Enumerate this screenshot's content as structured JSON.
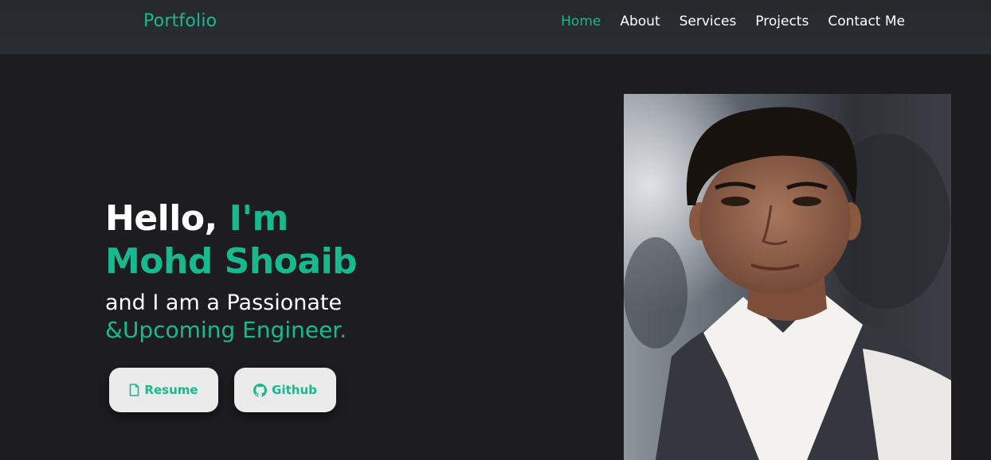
{
  "navbar": {
    "brand": "Portfolio",
    "links": [
      {
        "label": "Home",
        "active": true
      },
      {
        "label": "About",
        "active": false
      },
      {
        "label": "Services",
        "active": false
      },
      {
        "label": "Projects",
        "active": false
      },
      {
        "label": "Contact Me",
        "active": false
      }
    ]
  },
  "hero": {
    "hello": "Hello,",
    "im": "I'm",
    "name": "Mohd Shoaib",
    "line1": "and I am a Passionate",
    "line2": "&Upcoming Engineer."
  },
  "buttons": {
    "resume": {
      "label": "Resume",
      "icon": "file-icon"
    },
    "github": {
      "label": "Github",
      "icon": "github-icon"
    }
  },
  "colors": {
    "accent": "#17b98e",
    "background": "#1d1d1f",
    "navbar": "#282b2f",
    "button_bg": "#ebebeb"
  },
  "photo": {
    "icon": "profile-photo"
  }
}
